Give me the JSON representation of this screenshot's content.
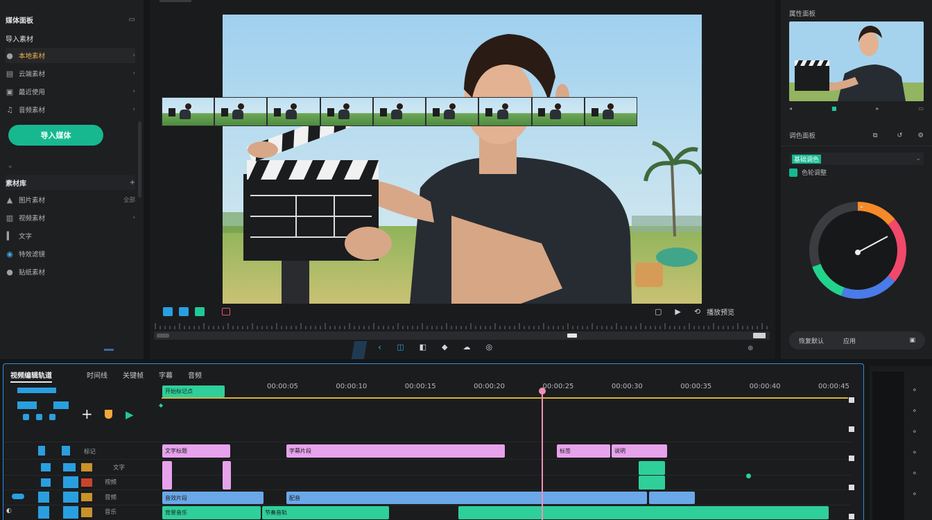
{
  "left_panel": {
    "header": "媒体面板",
    "section1": "导入素材",
    "items1": [
      {
        "icon": "folder-icon",
        "label": "本地素材"
      },
      {
        "icon": "cloud-icon",
        "label": "云端素材"
      },
      {
        "icon": "file-icon",
        "label": "最近使用"
      },
      {
        "icon": "music-icon",
        "label": "音频素材"
      }
    ],
    "primary_button": "导入媒体",
    "section2": "素材库",
    "items2": [
      {
        "icon": "image-icon",
        "label": "图片素材",
        "meta": "全部"
      },
      {
        "icon": "video-icon",
        "label": "视频素材",
        "meta": ""
      },
      {
        "icon": "text-icon",
        "label": "文字",
        "meta": ""
      },
      {
        "icon": "globe-icon",
        "label": "特效滤镜",
        "meta": ""
      },
      {
        "icon": "sticker-icon",
        "label": "贴纸素材",
        "meta": ""
      }
    ]
  },
  "viewer": {
    "status_label": "播放预览"
  },
  "right_panel": {
    "title": "属性面板",
    "sub_title": "调色面板",
    "preset_label": "基础调色",
    "preset_value": "色轮调整",
    "wheel_colors": [
      "#f58a2a",
      "#f2486a",
      "#4a7be8",
      "#22d38c",
      "#3a3c40"
    ],
    "bottom_left": "恢复默认",
    "bottom_mid": "应用"
  },
  "timeline": {
    "tabs": [
      "视频编辑轨道",
      "时间线",
      "关键帧",
      "字幕",
      "音频"
    ],
    "time_labels": [
      "00:00:05",
      "00:00:10",
      "00:00:15",
      "00:00:20",
      "00:00:25",
      "00:00:30",
      "00:00:35",
      "00:00:40",
      "00:00:45"
    ],
    "marker_label": "开始标记点",
    "track_labels": [
      "标记",
      "文字",
      "视频",
      "音频",
      "音乐"
    ],
    "clip_labels": {
      "pink1": "文字标题",
      "pink2": "字幕片段",
      "pink3": "标签",
      "pink4": "说明",
      "blue1": "音效片段",
      "blue2": "配音",
      "green1": "背景音乐",
      "green2": "节奏音轨"
    }
  }
}
